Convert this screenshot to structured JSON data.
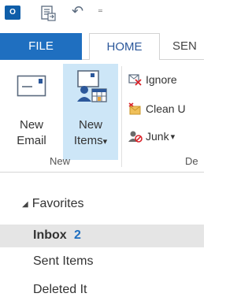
{
  "quick_access": {
    "app_icon": "outlook-icon",
    "send_receive_icon": "send-receive-icon",
    "undo_icon": "undo-icon",
    "customize_icon": "customize-qat-icon",
    "undo_glyph": "↶",
    "customize_glyph": "₌"
  },
  "tabs": {
    "file": "FILE",
    "home": "HOME",
    "send": "SEN"
  },
  "ribbon": {
    "new_group": {
      "new_email_label_1": "New",
      "new_email_label_2": "Email",
      "new_items_label_1": "New",
      "new_items_label_2": "Items",
      "new_items_caret": "▾",
      "group_label": "New"
    },
    "delete_group": {
      "ignore": "Ignore",
      "clean_up": "Clean U",
      "junk": "Junk",
      "junk_caret": "▾",
      "group_label_partial": "De"
    }
  },
  "favorites": {
    "header": "Favorites",
    "header_caret": "◢",
    "items": [
      {
        "label": "Inbox",
        "count": "2"
      },
      {
        "label": "Sent Items"
      },
      {
        "label": "Deleted It"
      }
    ]
  },
  "colors": {
    "accent": "#1f6fc0",
    "ribbon_highlight": "#cde6f7",
    "selected_row": "#e5e5e5"
  }
}
